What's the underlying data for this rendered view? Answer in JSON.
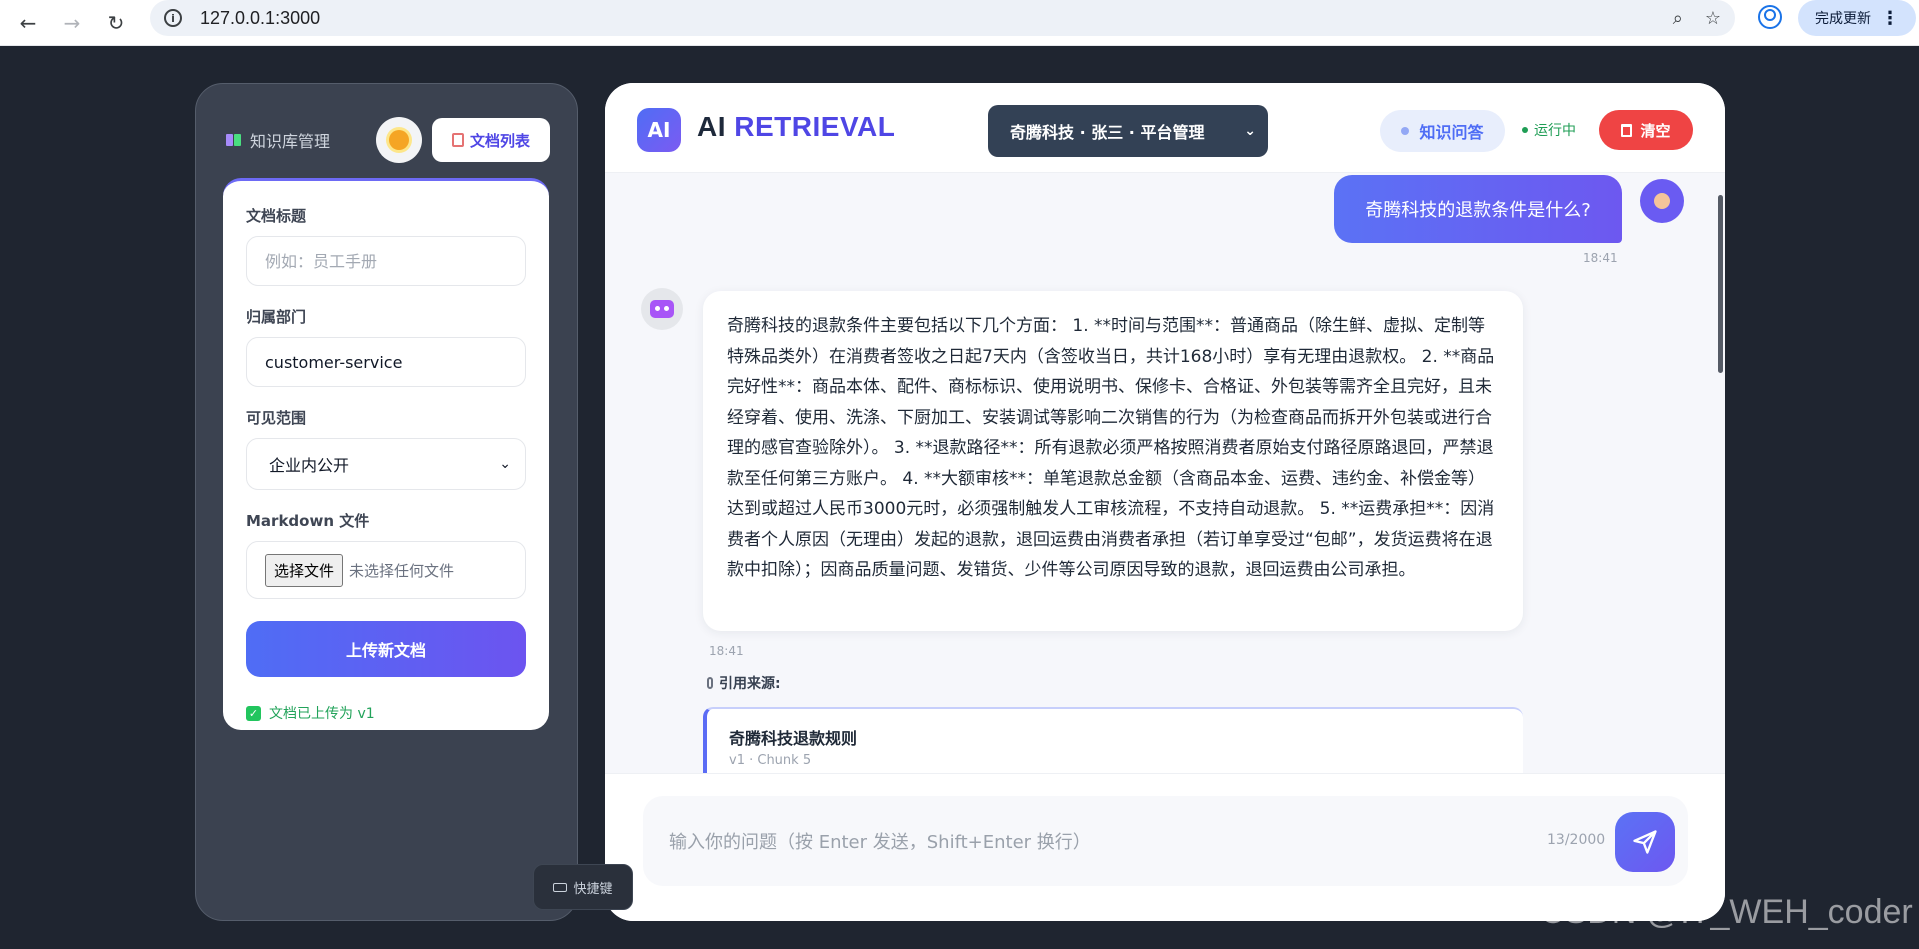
{
  "browser": {
    "url": "127.0.0.1:3000",
    "update_label": "完成更新"
  },
  "sidebar": {
    "title": "知识库管理",
    "doc_list_label": "文档列表",
    "form": {
      "title_label": "文档标题",
      "title_placeholder": "例如：员工手册",
      "department_label": "归属部门",
      "department_value": "customer-service",
      "visibility_label": "可见范围",
      "visibility_value": "企业内公开",
      "file_label": "Markdown 文件",
      "file_button": "选择文件",
      "file_status": "未选择任何文件",
      "upload_label": "上传新文档",
      "upload_status": "文档已上传为 v1"
    },
    "shortcut_label": "快捷键"
  },
  "header": {
    "logo_badge": "AI",
    "logo_ai": "AI ",
    "logo_retrieval": "RETRIEVAL",
    "tenant": "奇腾科技 · 张三 · 平台管理",
    "qa_label": "知识问答",
    "status": "运行中",
    "clear_label": "清空"
  },
  "chat": {
    "user_message": "奇腾科技的退款条件是什么?",
    "user_time": "18:41",
    "bot_message": "奇腾科技的退款条件主要包括以下几个方面： 1. **时间与范围**：普通商品（除生鲜、虚拟、定制等特殊品类外）在消费者签收之日起7天内（含签收当日，共计168小时）享有无理由退款权。 2. **商品完好性**：商品本体、配件、商标标识、使用说明书、保修卡、合格证、外包装等需齐全且完好，且未经穿着、使用、洗涤、下厨加工、安装调试等影响二次销售的行为（为检查商品而拆开外包装或进行合理的感官查验除外）。 3. **退款路径**：所有退款必须严格按照消费者原始支付路径原路退回，严禁退款至任何第三方账户。 4. **大额审核**：单笔退款总金额（含商品本金、运费、违约金、补偿金等）达到或超过人民币3000元时，必须强制触发人工审核流程，不支持自动退款。 5. **运费承担**：因消费者个人原因（无理由）发起的退款，退回运费由消费者承担（若订单享受过“包邮”，发货运费将在退款中扣除）；因商品质量问题、发错货、少件等公司原因导致的退款，退回运费由公司承担。",
    "bot_time": "18:41",
    "citation_label": "引用来源:",
    "citation": {
      "title": "奇腾科技退款规则",
      "meta": "v1 · Chunk 5"
    }
  },
  "composer": {
    "placeholder": "输入你的问题（按 Enter 发送，Shift+Enter 换行）",
    "char_count": "13/2000"
  },
  "watermark": "CSDN @IT_WEH_coder",
  "colors": {
    "accent": "#5b6cf5",
    "danger": "#ef4444",
    "success": "#22a35a",
    "tenant_bg": "#334155"
  }
}
